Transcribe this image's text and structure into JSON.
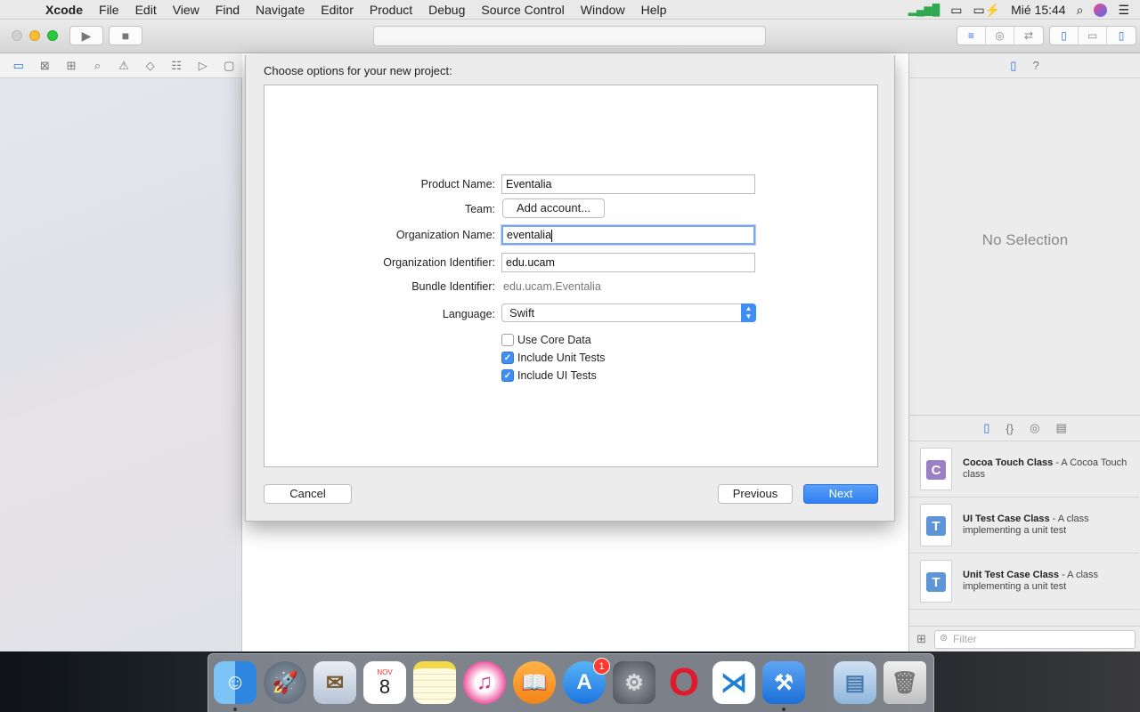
{
  "menubar": {
    "items": [
      "Xcode",
      "File",
      "Edit",
      "View",
      "Find",
      "Navigate",
      "Editor",
      "Product",
      "Debug",
      "Source Control",
      "Window",
      "Help"
    ],
    "clock": "Mié 15:44"
  },
  "sheet": {
    "title": "Choose options for your new project:",
    "product_name_label": "Product Name:",
    "product_name_value": "Eventalia",
    "team_label": "Team:",
    "team_button": "Add account...",
    "org_name_label": "Organization Name:",
    "org_name_value": "eventalia",
    "org_id_label": "Organization Identifier:",
    "org_id_value": "edu.ucam",
    "bundle_label": "Bundle Identifier:",
    "bundle_value": "edu.ucam.Eventalia",
    "language_label": "Language:",
    "language_value": "Swift",
    "use_core_data": "Use Core Data",
    "use_core_data_checked": false,
    "include_unit_tests": "Include Unit Tests",
    "include_unit_tests_checked": true,
    "include_ui_tests": "Include UI Tests",
    "include_ui_tests_checked": true,
    "cancel": "Cancel",
    "previous": "Previous",
    "next": "Next"
  },
  "inspector": {
    "no_selection": "No Selection",
    "library": [
      {
        "icon_letter": "C",
        "icon_color": "#9b7fc4",
        "title": "Cocoa Touch Class",
        "desc": " - A Cocoa Touch class"
      },
      {
        "icon_letter": "T",
        "icon_color": "#5d95d6",
        "title": "UI Test Case Class",
        "desc": " - A class implementing a unit test"
      },
      {
        "icon_letter": "T",
        "icon_color": "#5d95d6",
        "title": "Unit Test Case Class",
        "desc": " - A class implementing a unit test"
      }
    ],
    "filter_placeholder": "Filter"
  },
  "dock": {
    "calendar_month": "NOV",
    "calendar_day": "8",
    "appstore_badge": "1"
  }
}
